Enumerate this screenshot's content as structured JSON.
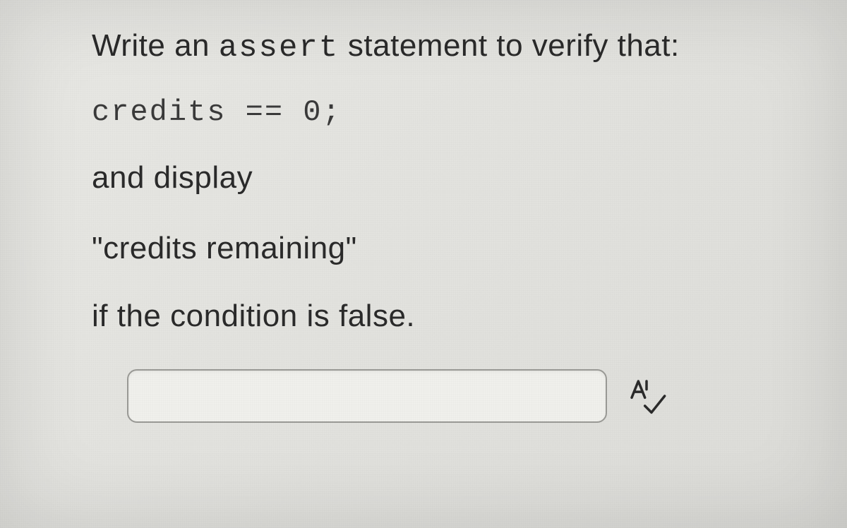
{
  "question": {
    "line1_pre": "Write an ",
    "line1_code": "assert",
    "line1_post": " statement to verify that:",
    "code_line": "credits == 0;",
    "line3": "and display",
    "line4": "\"credits remaining\"",
    "line5": "if the condition is false."
  },
  "answer": {
    "value": ""
  },
  "icons": {
    "spellcheck": "spellcheck-icon"
  }
}
